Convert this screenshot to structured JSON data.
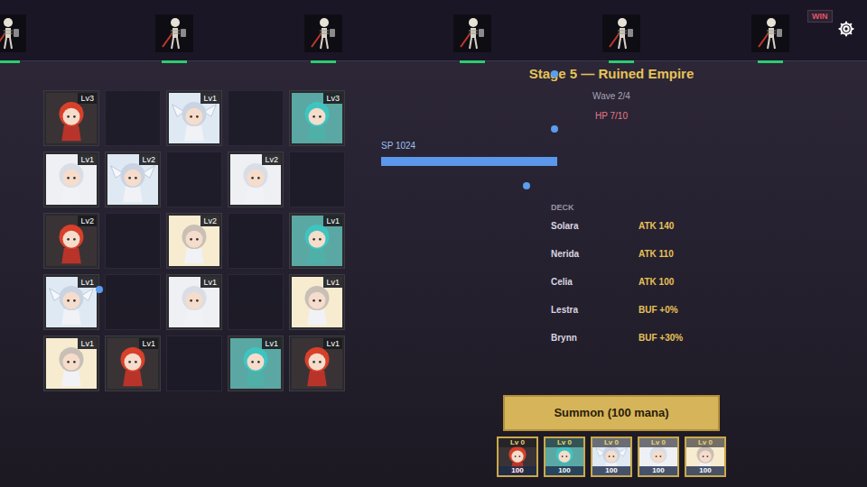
{
  "enemies": [
    {
      "health": 1
    },
    {
      "health": 1
    },
    {
      "health": 1
    },
    {
      "health": 1
    },
    {
      "health": 1
    },
    {
      "health": 1
    }
  ],
  "badge": "WIN",
  "stage": {
    "title": "Stage 5 — Ruined Empire",
    "wave": "Wave 2/4",
    "hp": "HP 7/10"
  },
  "sp": {
    "label": "SP 1024",
    "level": 1
  },
  "deck": {
    "title": "DECK",
    "items": [
      {
        "name": "Solara",
        "stat": "ATK 140"
      },
      {
        "name": "Nerida",
        "stat": "ATK 110"
      },
      {
        "name": "Celia",
        "stat": "ATK 100"
      },
      {
        "name": "Lestra",
        "stat": "BUF +0%"
      },
      {
        "name": "Brynn",
        "stat": "BUF +30%"
      }
    ]
  },
  "grid": [
    [
      {
        "kind": "solara",
        "level": "Lv3",
        "color": "#3a3336"
      },
      {
        "kind": "empty"
      },
      {
        "kind": "celia",
        "level": "Lv1",
        "color": "#dfe9f4"
      },
      {
        "kind": "empty"
      },
      {
        "kind": "nerida",
        "level": "Lv3",
        "color": "#5aa7a4"
      }
    ],
    [
      {
        "kind": "lestra",
        "level": "Lv1",
        "color": "#eef0f4"
      },
      {
        "kind": "celia",
        "level": "Lv2",
        "color": "#dfe9f4"
      },
      {
        "kind": "empty"
      },
      {
        "kind": "lestra",
        "level": "Lv2",
        "color": "#eef0f4"
      },
      {
        "kind": "empty"
      }
    ],
    [
      {
        "kind": "solara",
        "level": "Lv2",
        "color": "#3a3336"
      },
      {
        "kind": "empty"
      },
      {
        "kind": "brynn",
        "level": "Lv2",
        "color": "#f7ecd0"
      },
      {
        "kind": "empty"
      },
      {
        "kind": "nerida",
        "level": "Lv1",
        "color": "#5aa7a4"
      }
    ],
    [
      {
        "kind": "celia",
        "level": "Lv1",
        "color": "#dfe9f4"
      },
      {
        "kind": "empty"
      },
      {
        "kind": "lestra",
        "level": "Lv1",
        "color": "#eef0f4"
      },
      {
        "kind": "empty"
      },
      {
        "kind": "brynn",
        "level": "Lv1",
        "color": "#f7ecd0"
      }
    ],
    [
      {
        "kind": "brynn",
        "level": "Lv1",
        "color": "#f7ecd0"
      },
      {
        "kind": "solara",
        "level": "Lv1",
        "color": "#3a3336"
      },
      {
        "kind": "empty"
      },
      {
        "kind": "nerida",
        "level": "Lv1",
        "color": "#5aa7a4"
      },
      {
        "kind": "solara",
        "level": "Lv1",
        "color": "#3a3336"
      }
    ]
  ],
  "summon": {
    "label": "Summon (100 mana)"
  },
  "hand": [
    {
      "kind": "solara",
      "level": "Lv 0",
      "cost": "100",
      "color": "#3a3336"
    },
    {
      "kind": "nerida",
      "level": "Lv 0",
      "cost": "100",
      "color": "#5aa7a4"
    },
    {
      "kind": "celia",
      "level": "Lv 0",
      "cost": "100",
      "color": "#dfe9f4"
    },
    {
      "kind": "lestra",
      "level": "Lv 0",
      "cost": "100",
      "color": "#eef0f4"
    },
    {
      "kind": "brynn",
      "level": "Lv 0",
      "cost": "100",
      "color": "#f7ecd0"
    }
  ]
}
